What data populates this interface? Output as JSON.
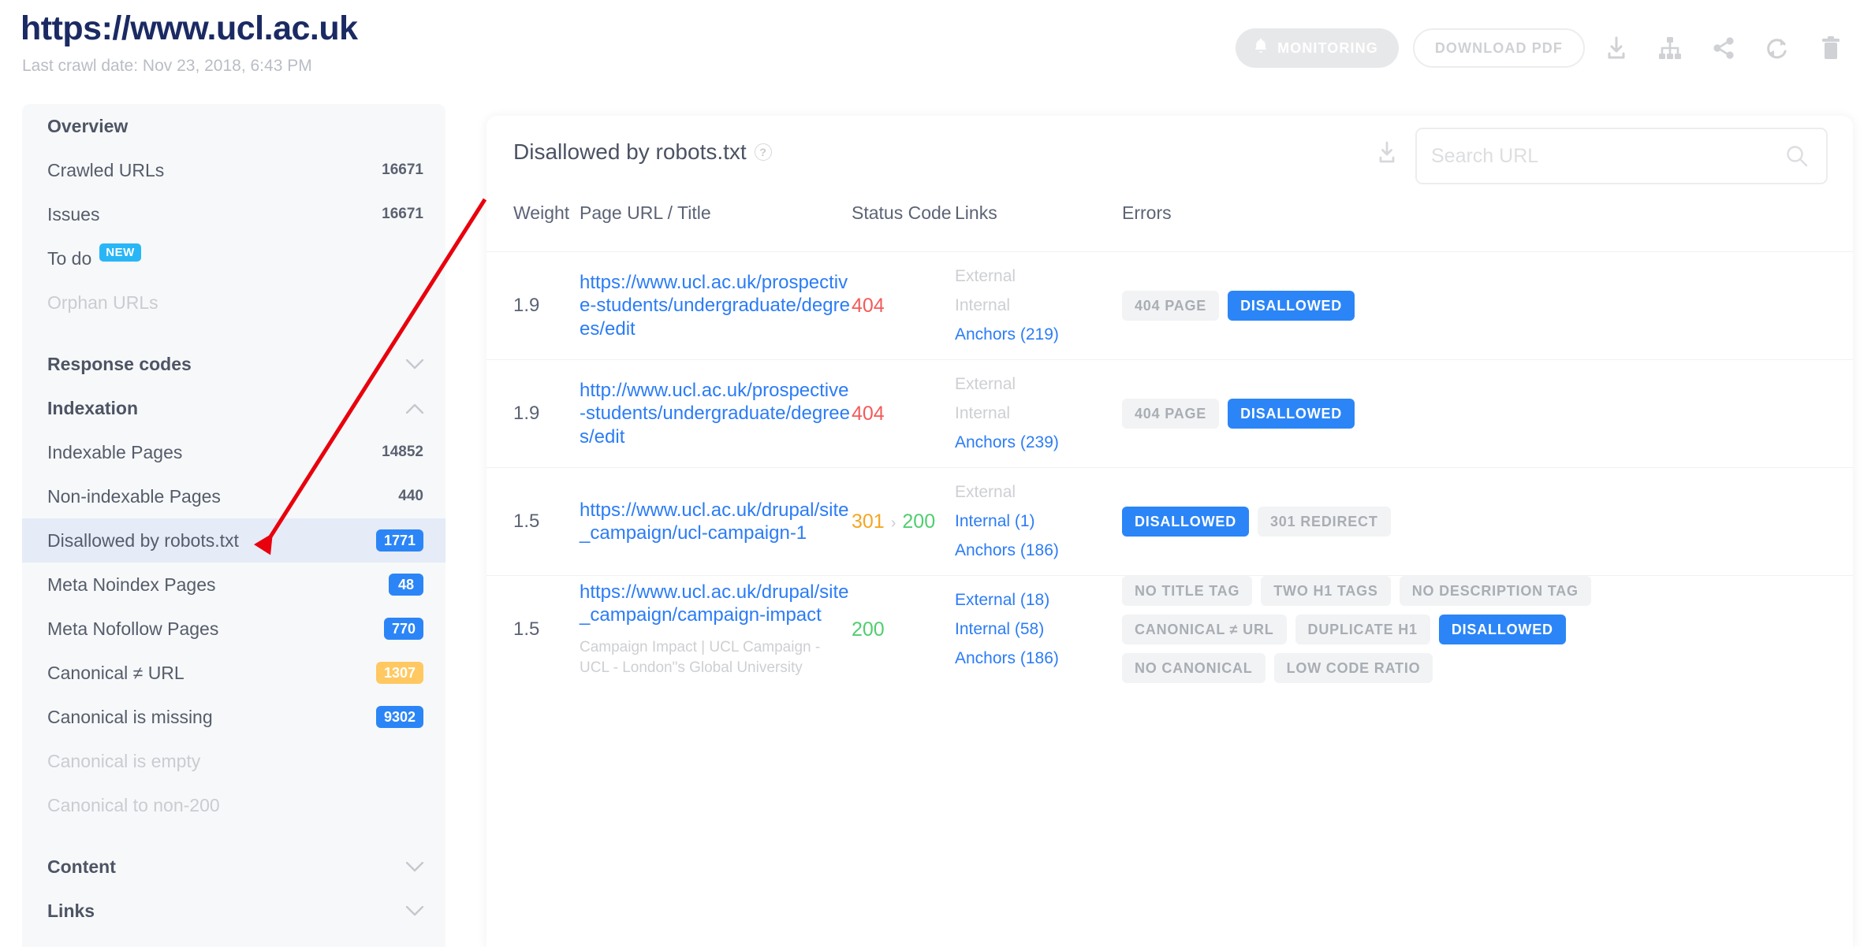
{
  "header": {
    "site_url": "https://www.ucl.ac.uk",
    "last_crawl": "Last crawl date: Nov 23, 2018, 6:43 PM",
    "monitoring_label": "MONITORING",
    "download_pdf_label": "DOWNLOAD PDF",
    "icons": [
      "download-icon",
      "sitemap-icon",
      "share-icon",
      "refresh-icon",
      "trash-icon"
    ]
  },
  "sidebar": {
    "items": [
      {
        "label": "Overview",
        "count": null,
        "style": "bold"
      },
      {
        "label": "Crawled URLs",
        "count": "16671",
        "style": "normal"
      },
      {
        "label": "Issues",
        "count": "16671",
        "style": "normal"
      },
      {
        "label": "To do",
        "count": null,
        "style": "normal",
        "new_badge": "NEW"
      },
      {
        "label": "Orphan URLs",
        "count": null,
        "style": "muted"
      },
      {
        "label": "Response codes",
        "count": null,
        "style": "bold",
        "chevron": "down"
      },
      {
        "label": "Indexation",
        "count": null,
        "style": "bold",
        "chevron": "up"
      },
      {
        "label": "Indexable Pages",
        "count": "14852",
        "style": "normal"
      },
      {
        "label": "Non-indexable Pages",
        "count": "440",
        "style": "normal"
      },
      {
        "label": "Disallowed by robots.txt",
        "badge": "1771",
        "badge_color": "blue",
        "style": "normal",
        "active": true
      },
      {
        "label": "Meta Noindex Pages",
        "badge": "48",
        "badge_color": "blue",
        "style": "normal"
      },
      {
        "label": "Meta Nofollow Pages",
        "badge": "770",
        "badge_color": "blue",
        "style": "normal"
      },
      {
        "label": "Canonical ≠ URL",
        "badge": "1307",
        "badge_color": "orange",
        "style": "normal"
      },
      {
        "label": "Canonical is missing",
        "badge": "9302",
        "badge_color": "blue",
        "style": "normal"
      },
      {
        "label": "Canonical is empty",
        "count": null,
        "style": "muted"
      },
      {
        "label": "Canonical to non-200",
        "count": null,
        "style": "muted"
      },
      {
        "label": "Content",
        "count": null,
        "style": "bold",
        "chevron": "down"
      },
      {
        "label": "Links",
        "count": null,
        "style": "bold",
        "chevron": "down"
      }
    ]
  },
  "main": {
    "title": "Disallowed by robots.txt",
    "help_icon": "question-mark-icon",
    "export_icon": "export-icon",
    "search": {
      "value": "",
      "placeholder": "Search URL"
    },
    "columns": [
      "Weight",
      "Page URL / Title",
      "Status Code",
      "Links",
      "Errors"
    ],
    "rows": [
      {
        "weight": "1.9",
        "url": "https://www.ucl.ac.uk/prospective-students/undergraduate/degrees/edit",
        "title": "",
        "status": {
          "codes": [
            "404"
          ],
          "types": [
            "err"
          ]
        },
        "links": [
          {
            "text": "External",
            "dim": true
          },
          {
            "text": "Internal",
            "dim": true
          },
          {
            "text": "Anchors (219)",
            "dim": false
          }
        ],
        "errors": [
          {
            "text": "404 PAGE",
            "highlight": false
          },
          {
            "text": "DISALLOWED",
            "highlight": true
          }
        ]
      },
      {
        "weight": "1.9",
        "url": "http://www.ucl.ac.uk/prospective-students/undergraduate/degrees/edit",
        "title": "",
        "status": {
          "codes": [
            "404"
          ],
          "types": [
            "err"
          ]
        },
        "links": [
          {
            "text": "External",
            "dim": true
          },
          {
            "text": "Internal",
            "dim": true
          },
          {
            "text": "Anchors (239)",
            "dim": false
          }
        ],
        "errors": [
          {
            "text": "404 PAGE",
            "highlight": false
          },
          {
            "text": "DISALLOWED",
            "highlight": true
          }
        ]
      },
      {
        "weight": "1.5",
        "url": "https://www.ucl.ac.uk/drupal/site_campaign/ucl-campaign-1",
        "title": "",
        "status": {
          "codes": [
            "301",
            "200"
          ],
          "types": [
            "warn",
            "ok"
          ]
        },
        "links": [
          {
            "text": "External",
            "dim": true
          },
          {
            "text": "Internal (1)",
            "dim": false
          },
          {
            "text": "Anchors (186)",
            "dim": false
          }
        ],
        "errors": [
          {
            "text": "DISALLOWED",
            "highlight": true
          },
          {
            "text": "301 REDIRECT",
            "highlight": false
          }
        ]
      },
      {
        "weight": "1.5",
        "url": "https://www.ucl.ac.uk/drupal/site_campaign/campaign-impact",
        "title": "Campaign Impact | UCL Campaign - UCL - London\"s Global University",
        "status": {
          "codes": [
            "200"
          ],
          "types": [
            "ok"
          ]
        },
        "links": [
          {
            "text": "External (18)",
            "dim": false
          },
          {
            "text": "Internal (58)",
            "dim": false
          },
          {
            "text": "Anchors (186)",
            "dim": false
          }
        ],
        "errors": [
          {
            "text": "NO TITLE TAG",
            "highlight": false
          },
          {
            "text": "TWO H1 TAGS",
            "highlight": false
          },
          {
            "text": "NO DESCRIPTION TAG",
            "highlight": false
          },
          {
            "text": "CANONICAL ≠ URL",
            "highlight": false
          },
          {
            "text": "DUPLICATE H1",
            "highlight": false
          },
          {
            "text": "DISALLOWED",
            "highlight": true
          },
          {
            "text": "NO CANONICAL",
            "highlight": false
          },
          {
            "text": "LOW CODE RATIO",
            "highlight": false
          }
        ]
      }
    ]
  },
  "annotation": {
    "arrow_color": "#e8000d"
  },
  "colors": {
    "brand_navy": "#1b2a63",
    "accent_blue": "#2b85f7",
    "warn_orange": "#ffc861",
    "error_red": "#f45a5a",
    "ok_green": "#4fce6f"
  }
}
